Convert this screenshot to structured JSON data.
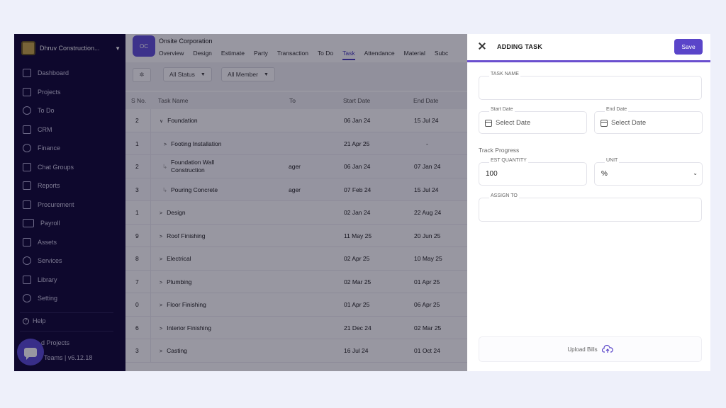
{
  "sidebar": {
    "org_name": "Dhruv Construction...",
    "items": [
      {
        "label": "Dashboard",
        "icon": "dashboard-icon"
      },
      {
        "label": "Projects",
        "icon": "home-icon"
      },
      {
        "label": "To Do",
        "icon": "todo-icon"
      },
      {
        "label": "CRM",
        "icon": "crm-icon"
      },
      {
        "label": "Finance",
        "icon": "finance-icon"
      },
      {
        "label": "Chat Groups",
        "icon": "chat-icon"
      },
      {
        "label": "Reports",
        "icon": "report-icon"
      },
      {
        "label": "Procurement",
        "icon": "procurement-icon"
      },
      {
        "label": "Payroll",
        "icon": "payroll-icon"
      },
      {
        "label": "Assets",
        "icon": "assets-icon"
      },
      {
        "label": "Services",
        "icon": "services-icon"
      },
      {
        "label": "Library",
        "icon": "library-icon"
      },
      {
        "label": "Setting",
        "icon": "gear-icon"
      }
    ],
    "help_label": "Help",
    "projects_label": "d Projects",
    "version_label": "Teams | v6.12.18"
  },
  "project": {
    "avatar": "OC",
    "name": "Onsite Corporation",
    "tabs": [
      "Overview",
      "Design",
      "Estimate",
      "Party",
      "Transaction",
      "To Do",
      "Task",
      "Attendance",
      "Material",
      "Subc"
    ],
    "active_tab": "Task"
  },
  "toolbar": {
    "filter_icon": "sparkle",
    "status_select": "All Status",
    "member_select": "All Member"
  },
  "table": {
    "headers": {
      "sno": "S No.",
      "task": "Task Name",
      "to": "To",
      "start": "Start Date",
      "end": "End Date"
    },
    "rows": [
      {
        "sno": "2",
        "task": "Foundation",
        "to": "",
        "start": "06 Jan 24",
        "end": "15 Jul 24",
        "expanded": true,
        "level": 0
      },
      {
        "sno": "1",
        "task": "Footing Installation",
        "to": "",
        "start": "21 Apr 25",
        "end": "-",
        "level": 1
      },
      {
        "sno": "2",
        "task": "Foundation Wall Construction",
        "to": "ager",
        "start": "06 Jan 24",
        "end": "07 Jan 24",
        "level": 2
      },
      {
        "sno": "3",
        "task": "Pouring Concrete",
        "to": "ager",
        "start": "07 Feb 24",
        "end": "15 Jul 24",
        "level": 2
      },
      {
        "sno": "1",
        "task": "Design",
        "to": "",
        "start": "02 Jan 24",
        "end": "22 Aug 24",
        "level": 0
      },
      {
        "sno": "9",
        "task": "Roof Finishing",
        "to": "",
        "start": "11 May 25",
        "end": "20 Jun 25",
        "level": 0
      },
      {
        "sno": "8",
        "task": "Electrical",
        "to": "",
        "start": "02 Apr 25",
        "end": "10 May 25",
        "level": 0
      },
      {
        "sno": "7",
        "task": "Plumbing",
        "to": "",
        "start": "02 Mar 25",
        "end": "01 Apr 25",
        "level": 0
      },
      {
        "sno": "0",
        "task": "Floor Finishing",
        "to": "",
        "start": "01 Apr 25",
        "end": "06 Apr 25",
        "level": 0
      },
      {
        "sno": "6",
        "task": "Interior Finishing",
        "to": "",
        "start": "21 Dec 24",
        "end": "02 Mar 25",
        "level": 0
      },
      {
        "sno": "3",
        "task": "Casting",
        "to": "",
        "start": "16 Jul 24",
        "end": "01 Oct 24",
        "level": 0
      }
    ]
  },
  "drawer": {
    "title": "ADDING TASK",
    "save_label": "Save",
    "task_name_label": "TASK NAME",
    "task_name_value": "",
    "start_date_label": "Start Date",
    "start_date_placeholder": "Select Date",
    "end_date_label": "End Date",
    "end_date_placeholder": "Select Date",
    "track_progress_label": "Track Progress",
    "est_quantity_label": "EST QUANTITY",
    "est_quantity_value": "100",
    "unit_label": "UNIT",
    "unit_value": "%",
    "assign_to_label": "ASSIGN TO",
    "assign_to_value": "",
    "upload_label": "Upload Bills"
  },
  "colors": {
    "sidebar_bg": "#120a38",
    "accent": "#5a45c9",
    "page_bg": "#eef0fa"
  }
}
